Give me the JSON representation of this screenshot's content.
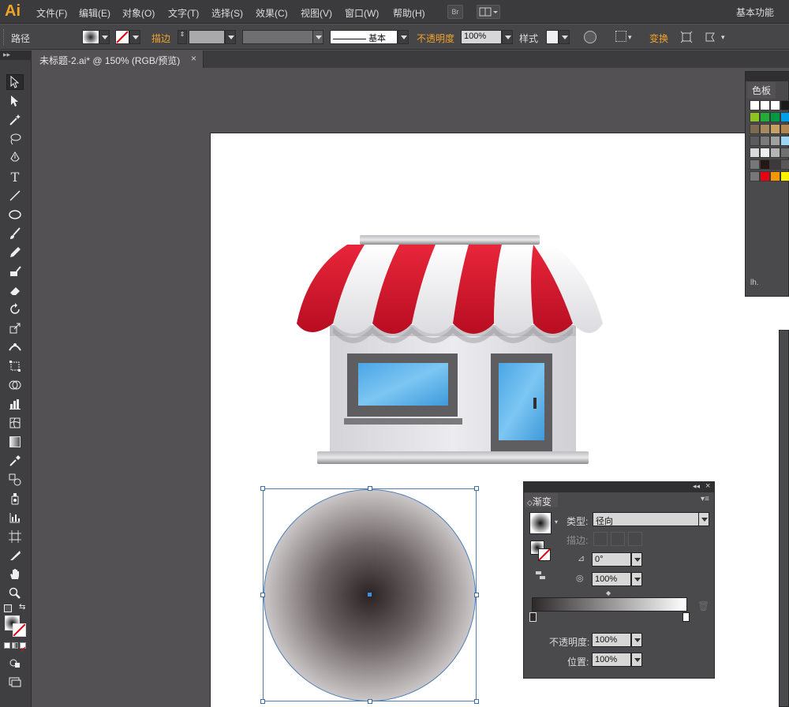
{
  "app": {
    "logo": "Ai",
    "workspace": "基本功能"
  },
  "menu": [
    {
      "label": "文件(F)"
    },
    {
      "label": "编辑(E)"
    },
    {
      "label": "对象(O)"
    },
    {
      "label": "文字(T)"
    },
    {
      "label": "选择(S)"
    },
    {
      "label": "效果(C)"
    },
    {
      "label": "视图(V)"
    },
    {
      "label": "窗口(W)"
    },
    {
      "label": "帮助(H)"
    }
  ],
  "menu_buttons": {
    "bridge": "Br"
  },
  "control": {
    "object_type": "路径",
    "stroke_label": "描边",
    "stroke_style": "基本",
    "opacity_label": "不透明度",
    "opacity_value": "100%",
    "style_label": "样式",
    "transform_label": "变换"
  },
  "document": {
    "tab_title": "未标题-2.ai* @ 150% (RGB/预览)",
    "close": "×"
  },
  "swatches": {
    "title": "色板",
    "footer": "lh.",
    "rows": [
      [
        "#ffffff",
        "#ffffff",
        "#ffffff",
        "#1a1a1a"
      ],
      [
        "#8fc31f",
        "#22ac38",
        "#009944",
        "#00a0e9"
      ],
      [
        "#7e6a4f",
        "#a58a5f",
        "#c7a064",
        "#b28850"
      ],
      [
        "#5b5b5b",
        "#7a7a7a",
        "#9fa0a0",
        "#9dd6f5"
      ],
      [
        "#d9d9d9",
        "#efefef",
        "#b5b5b6",
        "#6f7070"
      ],
      [
        "#777777",
        "#231815",
        "#3e3a39",
        "#595757"
      ],
      [
        "#777777",
        "#e60012",
        "#f39800",
        "#fff100"
      ]
    ]
  },
  "gradient_panel": {
    "title": "渐变",
    "type_label": "类型:",
    "type_value": "径向",
    "stroke_label": "描边:",
    "angle_value": "0°",
    "aspect_value": "100%",
    "opacity_label": "不透明度:",
    "opacity_value": "100%",
    "location_label": "位置:",
    "location_value": "100%",
    "gradient_start": "#2e2a2b",
    "gradient_end": "#ffffff"
  },
  "colors": {
    "awning_red": "#d5142a",
    "awning_white": "#f2f2f4",
    "wall": "#e2e2e5",
    "glass": "#59b4ea",
    "frame": "#636365",
    "radial_center": "#2a2324",
    "radial_edge": "#ffffff"
  }
}
